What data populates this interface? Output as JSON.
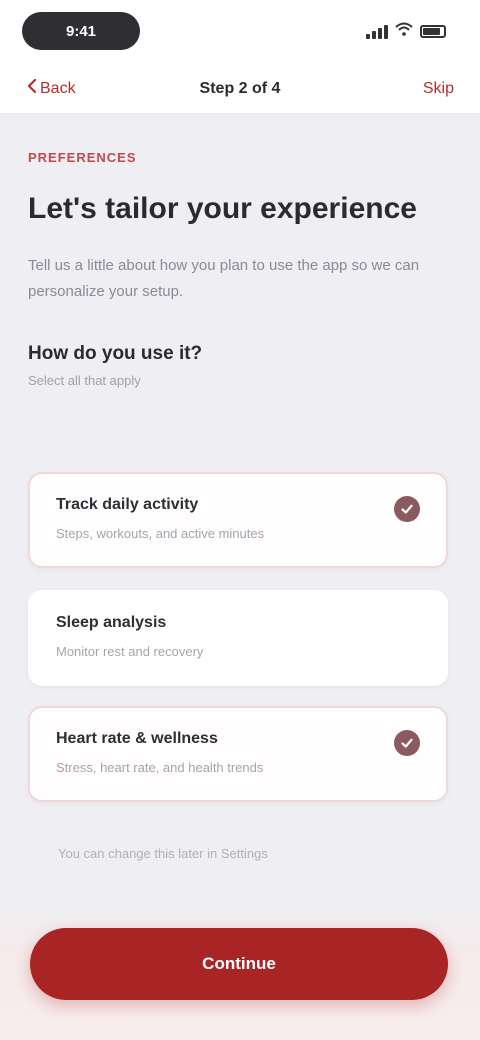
{
  "status_bar": {
    "time": "9:41"
  },
  "nav": {
    "back_label": "Back",
    "title": "Step 2 of 4",
    "right_label": "Skip"
  },
  "intro": {
    "eyebrow": "Preferences",
    "headline": "Let's tailor your experience",
    "body": "Tell us a little about how you plan to use the app so we can personalize your setup."
  },
  "question": {
    "title": "How do you use it?",
    "hint": "Select all that apply"
  },
  "options": [
    {
      "title": "Track daily activity",
      "desc": "Steps, workouts, and active minutes",
      "selected": true
    },
    {
      "title": "Sleep analysis",
      "desc": "Monitor rest and recovery",
      "selected": false
    },
    {
      "title": "Heart rate & wellness",
      "desc": "Stress, heart rate, and health trends",
      "selected": true
    }
  ],
  "footnote": "You can change this later in Settings",
  "cta_label": "Continue",
  "colors": {
    "accent": "#a92525",
    "selected_border": "#efd9d9",
    "check_fill": "#8a5a5e"
  }
}
